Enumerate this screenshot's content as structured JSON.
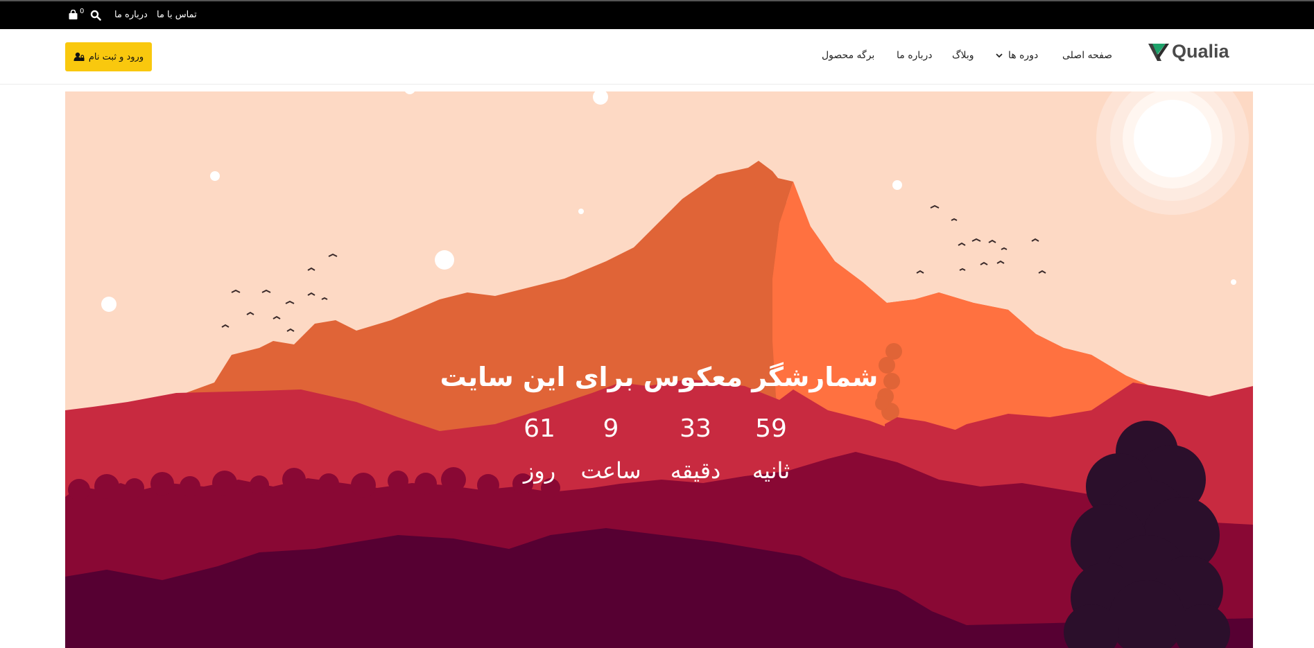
{
  "topbar": {
    "contact": "تماس با ما",
    "about": "درباره ما",
    "search_icon": "search-icon",
    "cart_icon": "shopping-bag-icon",
    "cart_count": "0"
  },
  "header": {
    "logo_text": "Qualia",
    "nav": {
      "home": "صفحه اصلی",
      "courses": "دوره ها",
      "blog": "وبلاگ",
      "about": "درباره ما",
      "product": "برگه محصول"
    },
    "login_label": "ورود و ثبت نام",
    "login_icon": "user-lock-icon"
  },
  "hero": {
    "title": "شمارشگر معکوس برای این سایت",
    "countdown": [
      {
        "value": "61",
        "label": "روز"
      },
      {
        "value": "9",
        "label": "ساعت"
      },
      {
        "value": "33",
        "label": "دقیقه"
      },
      {
        "value": "59",
        "label": "ثانیه"
      }
    ]
  },
  "colors": {
    "accent": "#f9c80e",
    "sky": "#fdd9c4",
    "mountain_dark": "#e06437",
    "mountain_light": "#ff7140",
    "hills_red": "#c82a40",
    "hills_wine": "#890834",
    "hills_dark": "#560032",
    "tree": "#2b0f2b"
  }
}
